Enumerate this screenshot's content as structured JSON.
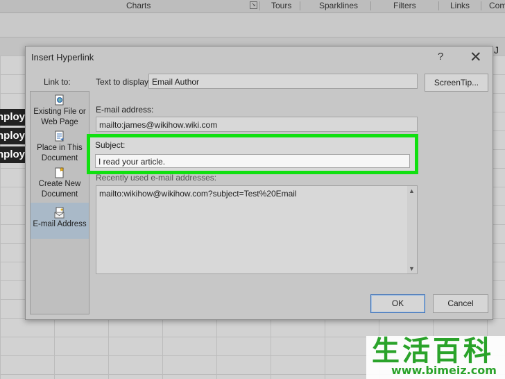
{
  "ribbon": {
    "groups": [
      "Charts",
      "Tours",
      "Sparklines",
      "Filters",
      "Links",
      "Com"
    ]
  },
  "sheet": {
    "column_j": "J",
    "rows_text": [
      "nploy",
      "nploy",
      "nploy"
    ]
  },
  "dialog": {
    "title": "Insert Hyperlink",
    "help_label": "?",
    "close_label": "✕",
    "link_to_label": "Link to:",
    "link_options": [
      {
        "label": "Existing File or Web Page",
        "icon": "existing-file-icon",
        "active": false
      },
      {
        "label": "Place in This Document",
        "icon": "place-in-document-icon",
        "active": false
      },
      {
        "label": "Create New Document",
        "icon": "new-document-icon",
        "active": false
      },
      {
        "label": "E-mail Address",
        "icon": "email-address-icon",
        "active": true
      }
    ],
    "text_to_display_label": "Text to display:",
    "text_to_display_value": "Email Author",
    "screentip_label": "ScreenTip...",
    "email_label": "E-mail address:",
    "email_value": "mailto:james@wikihow.wiki.com",
    "subject_label": "Subject:",
    "subject_value": "I read your article.",
    "recent_label": "Recently used e-mail addresses:",
    "recent_items": [
      "mailto:wikihow@wikihow.com?subject=Test%20Email"
    ],
    "ok_label": "OK",
    "cancel_label": "Cancel"
  },
  "highlight_color": "#10e010",
  "watermark": {
    "chars": "生活百科",
    "url": "www.bimeiz.com"
  }
}
